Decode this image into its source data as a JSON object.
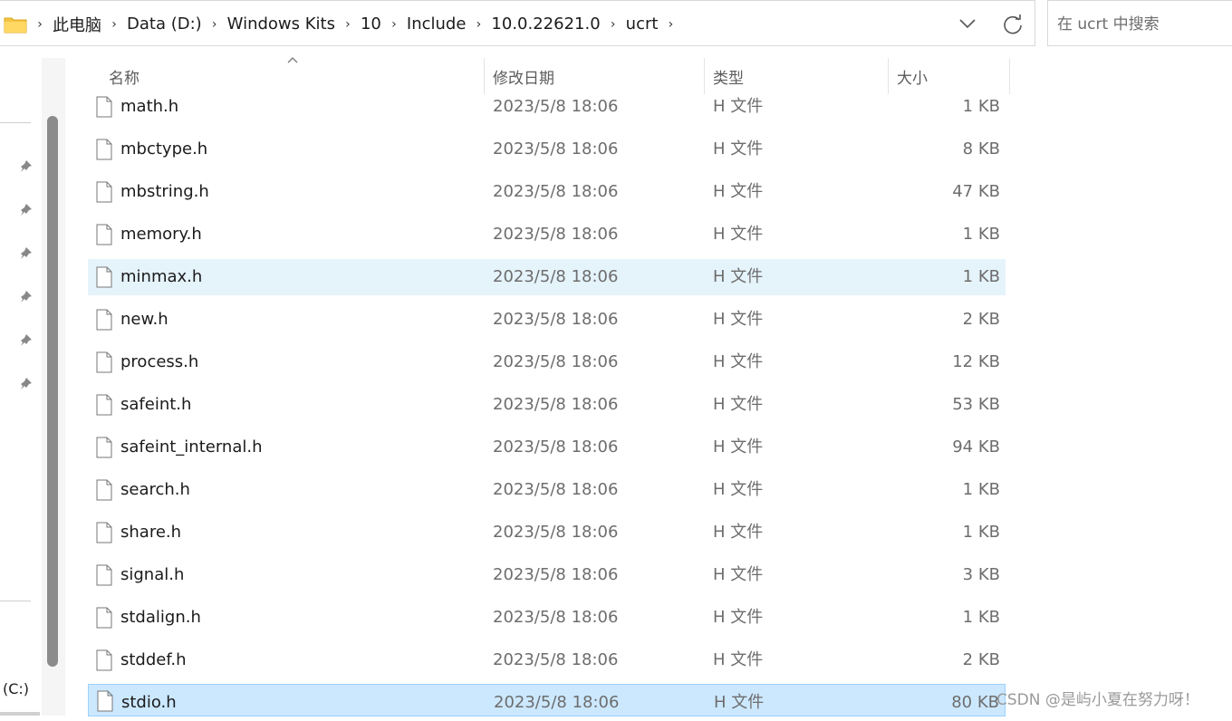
{
  "addressbar": {
    "crumbs": [
      "此电脑",
      "Data (D:)",
      "Windows Kits",
      "10",
      "Include",
      "10.0.22621.0",
      "ucrt"
    ]
  },
  "search": {
    "placeholder": "在 ucrt 中搜索"
  },
  "columns": {
    "name": "名称",
    "date": "修改日期",
    "type": "类型",
    "size": "大小"
  },
  "files": [
    {
      "name": "math.h",
      "date": "2023/5/8 18:06",
      "type": "H 文件",
      "size": "1 KB"
    },
    {
      "name": "mbctype.h",
      "date": "2023/5/8 18:06",
      "type": "H 文件",
      "size": "8 KB"
    },
    {
      "name": "mbstring.h",
      "date": "2023/5/8 18:06",
      "type": "H 文件",
      "size": "47 KB"
    },
    {
      "name": "memory.h",
      "date": "2023/5/8 18:06",
      "type": "H 文件",
      "size": "1 KB"
    },
    {
      "name": "minmax.h",
      "date": "2023/5/8 18:06",
      "type": "H 文件",
      "size": "1 KB"
    },
    {
      "name": "new.h",
      "date": "2023/5/8 18:06",
      "type": "H 文件",
      "size": "2 KB"
    },
    {
      "name": "process.h",
      "date": "2023/5/8 18:06",
      "type": "H 文件",
      "size": "12 KB"
    },
    {
      "name": "safeint.h",
      "date": "2023/5/8 18:06",
      "type": "H 文件",
      "size": "53 KB"
    },
    {
      "name": "safeint_internal.h",
      "date": "2023/5/8 18:06",
      "type": "H 文件",
      "size": "94 KB"
    },
    {
      "name": "search.h",
      "date": "2023/5/8 18:06",
      "type": "H 文件",
      "size": "1 KB"
    },
    {
      "name": "share.h",
      "date": "2023/5/8 18:06",
      "type": "H 文件",
      "size": "1 KB"
    },
    {
      "name": "signal.h",
      "date": "2023/5/8 18:06",
      "type": "H 文件",
      "size": "3 KB"
    },
    {
      "name": "stdalign.h",
      "date": "2023/5/8 18:06",
      "type": "H 文件",
      "size": "1 KB"
    },
    {
      "name": "stddef.h",
      "date": "2023/5/8 18:06",
      "type": "H 文件",
      "size": "2 KB"
    },
    {
      "name": "stdio.h",
      "date": "2023/5/8 18:06",
      "type": "H 文件",
      "size": "80 KB"
    }
  ],
  "nav": {
    "drive_label": "(C:)"
  },
  "watermark": "CSDN @是屿小夏在努力呀！",
  "colors": {
    "hover": "#e5f3fb",
    "selected": "#cce8ff",
    "selected_border": "#99d1ff",
    "folder": "#f5c542"
  }
}
